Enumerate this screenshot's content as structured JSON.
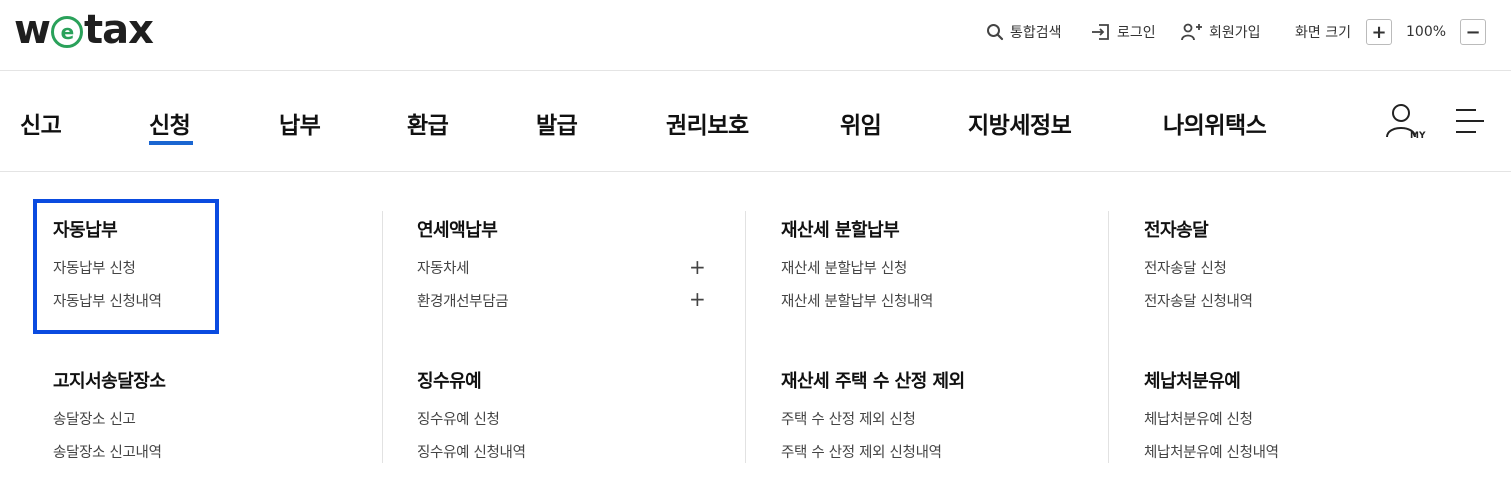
{
  "logo": {
    "pre": "w",
    "e": "e",
    "post": "tax"
  },
  "utility": {
    "search": "통합검색",
    "login": "로그인",
    "signup": "회원가입",
    "screen_size": "화면 크기",
    "zoom_in": "+",
    "zoom_level": "100%",
    "zoom_out": "−"
  },
  "nav": {
    "items": [
      "신고",
      "신청",
      "납부",
      "환급",
      "발급",
      "권리보호",
      "위임",
      "지방세정보",
      "나의위택스"
    ],
    "active": "신청"
  },
  "menu": {
    "groups": [
      {
        "title": "자동납부",
        "items": [
          "자동납부 신청",
          "자동납부 신청내역"
        ]
      },
      {
        "title": "연세액납부",
        "items": [
          "자동차세",
          "환경개선부담금"
        ],
        "expand_label": "+"
      },
      {
        "title": "재산세 분할납부",
        "items": [
          "재산세 분할납부 신청",
          "재산세 분할납부 신청내역"
        ]
      },
      {
        "title": "전자송달",
        "items": [
          "전자송달 신청",
          "전자송달 신청내역"
        ]
      },
      {
        "title": "고지서송달장소",
        "items": [
          "송달장소 신고",
          "송달장소 신고내역"
        ]
      },
      {
        "title": "징수유예",
        "items": [
          "징수유예 신청",
          "징수유예 신청내역"
        ]
      },
      {
        "title": "재산세 주택 수 산정 제외",
        "items": [
          "주택 수 산정 제외 신청",
          "주택 수 산정 제외 신청내역"
        ]
      },
      {
        "title": "체납처분유예",
        "items": [
          "체납처분유예 신청",
          "체납처분유예 신청내역"
        ]
      }
    ]
  },
  "colors": {
    "accent": "#1a66d1",
    "highlight": "#0a4be0",
    "logo_green": "#2aa15a"
  },
  "icons": [
    "search-icon",
    "login-icon",
    "signup-icon",
    "my-account-icon",
    "hamburger-menu-icon"
  ]
}
